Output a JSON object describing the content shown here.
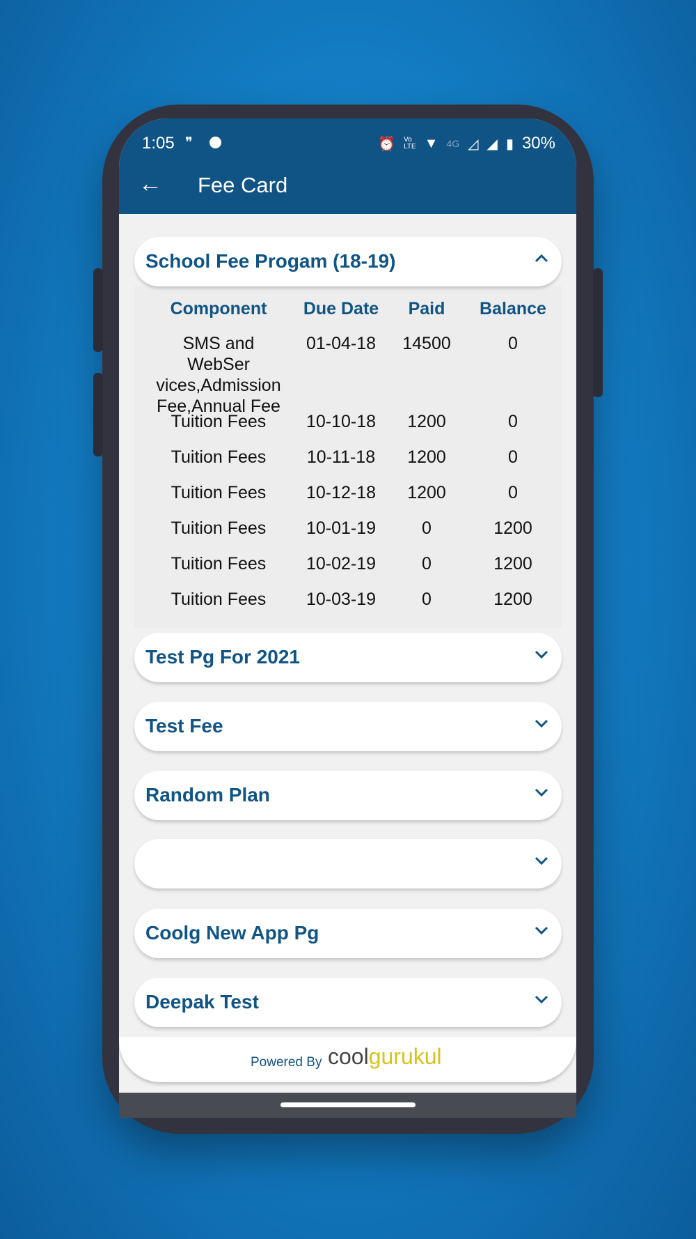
{
  "status_bar": {
    "time": "1:05",
    "network": "4G",
    "battery": "30%",
    "icons": [
      "hangouts-icon",
      "jio-icon",
      "alarm-icon",
      "volte-icon",
      "wifi-icon",
      "signal-icon",
      "signal-roaming-icon",
      "battery-icon"
    ]
  },
  "header": {
    "title": "Fee Card",
    "back_icon": "arrow-left-icon"
  },
  "expanded_plan": {
    "title": "School Fee Progam (18-19)",
    "columns": [
      "Component",
      "Due Date",
      "Paid",
      "Balance"
    ],
    "rows": [
      [
        "SMS and WebSer vices,Admission Fee,Annual Fee",
        "01-04-18",
        "14500",
        "0"
      ],
      [
        "Tuition Fees",
        "10-10-18",
        "1200",
        "0"
      ],
      [
        "Tuition Fees",
        "10-11-18",
        "1200",
        "0"
      ],
      [
        "Tuition Fees",
        "10-12-18",
        "1200",
        "0"
      ],
      [
        "Tuition Fees",
        "10-01-19",
        "0",
        "1200"
      ],
      [
        "Tuition Fees",
        "10-02-19",
        "0",
        "1200"
      ],
      [
        "Tuition Fees",
        "10-03-19",
        "0",
        "1200"
      ]
    ]
  },
  "plans": [
    "Test Pg For 2021",
    "Test Fee",
    "Random Plan",
    "",
    "Coolg New App Pg",
    "Deepak Test"
  ],
  "footer": {
    "powered_by": "Powered By",
    "logo_part1": "cool",
    "logo_part2": "gurukul"
  },
  "colors": {
    "primary": "#105486",
    "logo_dark": "#444444",
    "logo_yellow": "#d4c41e"
  }
}
